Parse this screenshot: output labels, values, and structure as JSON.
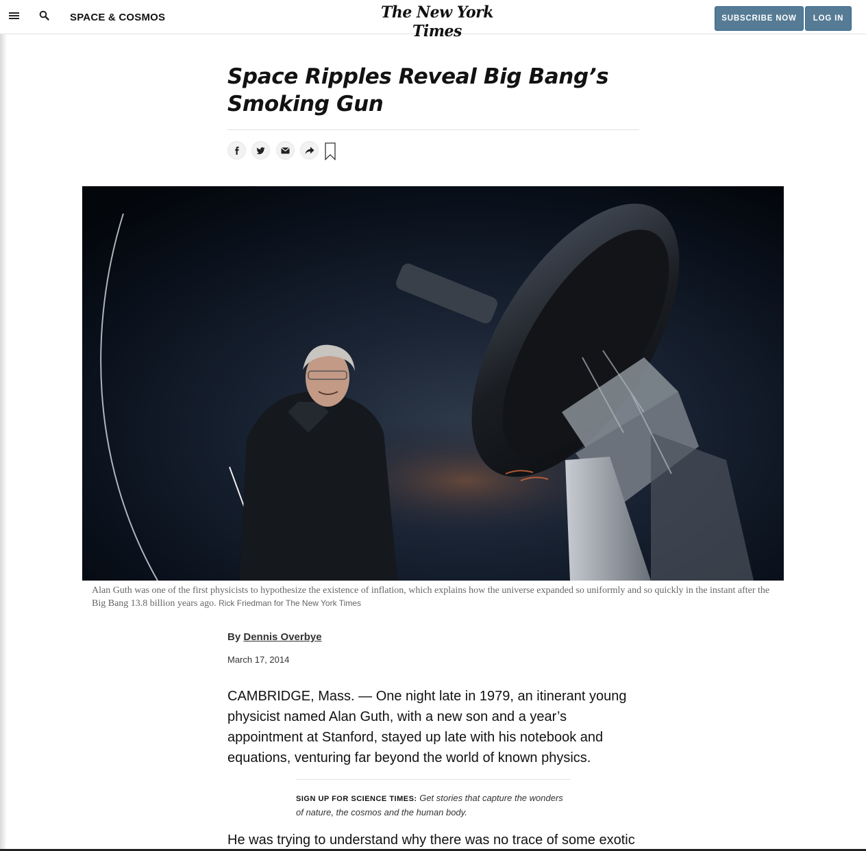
{
  "header": {
    "section": "SPACE & COSMOS",
    "logo": "The New York Times",
    "subscribe_label": "SUBSCRIBE NOW",
    "login_label": "LOG IN",
    "icons": [
      "menu-icon",
      "search-icon"
    ]
  },
  "article": {
    "headline": "Space Ripples Reveal Big Bang’s Smoking Gun",
    "share_icons": [
      "facebook-icon",
      "twitter-icon",
      "email-icon",
      "share-icon",
      "bookmark-icon"
    ],
    "photo": {
      "caption": "Alan Guth was one of the first physicists to hypothesize the existence of inflation, which explains how the universe expanded so uniformly and so quickly in the instant after the Big Bang 13.8 billion years ago.",
      "credit": "Rick Friedman for The New York Times"
    },
    "byline_prefix": "By",
    "author": "Dennis Overbye",
    "date": "March 17, 2014",
    "paragraphs": [
      "CAMBRIDGE, Mass. — One night late in 1979, an itinerant young physicist named Alan Guth, with a new son and a year’s appointment at Stanford, stayed up late with his notebook and equations, venturing far beyond the world of known physics.",
      "He was trying to understand why there was no trace of some exotic"
    ],
    "signup": {
      "label": "SIGN UP FOR SCIENCE TIMES:",
      "text": "Get stories that capture the wonders of nature, the cosmos and the human body."
    }
  },
  "colors": {
    "button_bg": "#567b95",
    "text": "#121212",
    "caption": "#666666"
  }
}
